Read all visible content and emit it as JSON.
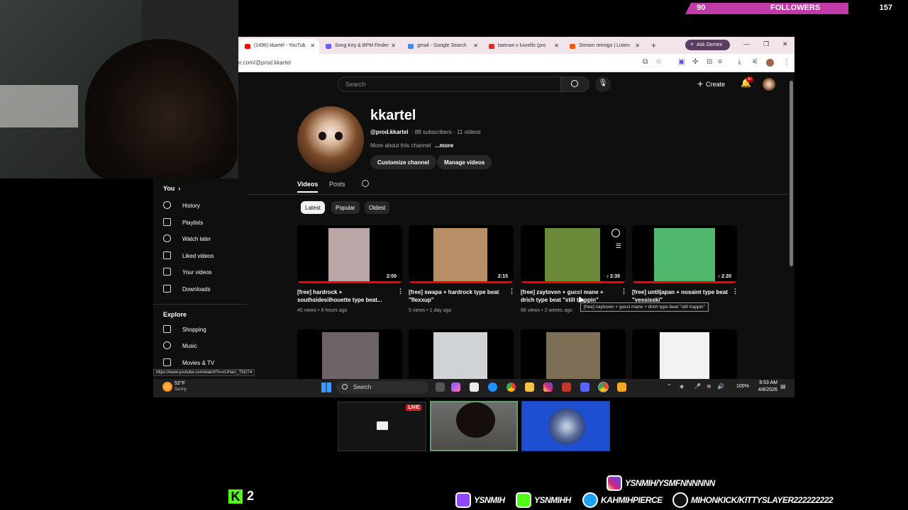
{
  "followers": {
    "current": "90",
    "label": "FOLLOWERS",
    "goal": "157",
    "bar_color": "#c03aa8"
  },
  "browser": {
    "tabs": [
      {
        "label": "(1496) kkartel - YouTub",
        "active": true
      },
      {
        "label": "Song Key & BPM Finder"
      },
      {
        "label": "gmail - Google Search"
      },
      {
        "label": "batman x luvrello (pro"
      },
      {
        "label": "Stream reimigo | Listen"
      }
    ],
    "gemini_label": "Ask Gemini",
    "url": "e.com/@prod.kkartel"
  },
  "youtube": {
    "search_placeholder": "Search",
    "create_label": "Create",
    "notif_badge": "9+",
    "channel": {
      "name": "kkartel",
      "handle": "@prod.kkartel",
      "meta": "· 88 subscribers · 11 videos",
      "description": "More about this channel",
      "more": "...more",
      "customize": "Customize channel",
      "manage": "Manage videos"
    },
    "tabs": {
      "videos": "Videos",
      "posts": "Posts"
    },
    "chips": {
      "latest": "Latest",
      "popular": "Popular",
      "oldest": "Oldest"
    },
    "videos": [
      {
        "title": "[free] hardrock + southsidesilhouette type beat...",
        "meta": "45 views • 8 hours ago",
        "duration": "2:00",
        "thumb_color": "#b9a7a8"
      },
      {
        "title": "[free] swapa + hardrock type beat \"flexxup\"",
        "meta": "5 views • 1 day ago",
        "duration": "2:15",
        "thumb_color": "#b88e66"
      },
      {
        "title": "[free] zaytoven + gucci mane + drich type beat \"still trappin\"",
        "meta": "86 views • 2 weeks ago",
        "duration": "♪ 2:35",
        "thumb_color": "#6b8a3a"
      },
      {
        "title": "[free] untiljapan + nosaint type beat \"vessisski\"",
        "meta": "",
        "duration": "♪ 2:20",
        "thumb_color": "#4fb86c"
      },
      {
        "thumb_color": "#6e6468"
      },
      {
        "thumb_color": "#cfd3d6"
      },
      {
        "thumb_color": "#7d6f55"
      },
      {
        "thumb_color": "#f2f2f2"
      }
    ],
    "tooltip": "[free] zaytoven + gucci mane + drich type beat \"still trappin\""
  },
  "sidebar": {
    "you": "You",
    "items": [
      "History",
      "Playlists",
      "Watch later",
      "Liked videos",
      "Your videos",
      "Downloads"
    ],
    "explore": "Explore",
    "explore_items": [
      "Shopping",
      "Music",
      "Movies & TV"
    ],
    "status_url": "https://www.youtube.com/watch?v=cUHaU_T5GT4"
  },
  "taskbar": {
    "temp": "52°F",
    "weather": "Sunny",
    "search": "Search",
    "battery": "100%",
    "time": "8:53 AM",
    "date": "4/8/2026"
  },
  "preview": {
    "live": "LIVE"
  },
  "kick": {
    "count": "2"
  },
  "socials": {
    "instagram": "YSNMIH/YSMFNNNNNN",
    "twitch": "YSNMIH",
    "kick": "YSNMIHH",
    "twitter": "KAHMIHPIERCE",
    "tiktok": "MIHONKICK/KITTYSLAYER222222222"
  }
}
